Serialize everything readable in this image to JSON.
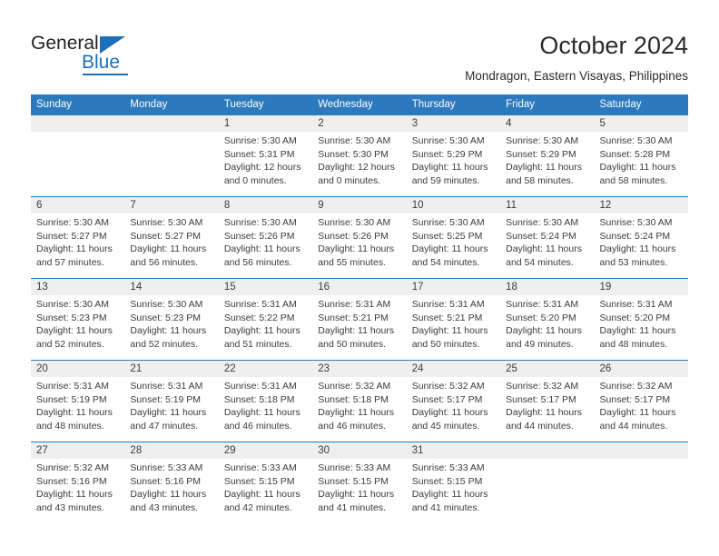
{
  "brand": {
    "name_part1": "General",
    "name_part2": "Blue",
    "triangle_icon": "triangle-icon",
    "color_blue": "#1b70b8",
    "color_dark": "#231f20"
  },
  "header": {
    "month_title": "October 2024",
    "location": "Mondragon, Eastern Visayas, Philippines"
  },
  "theme": {
    "header_blue": "#2c79bd",
    "daynum_band": "#efefef",
    "text": "#3b3b3b",
    "cell_bg": "#ffffff"
  },
  "calendar": {
    "weekday_headers": [
      "Sunday",
      "Monday",
      "Tuesday",
      "Wednesday",
      "Thursday",
      "Friday",
      "Saturday"
    ],
    "weeks": [
      [
        {
          "day": "",
          "lines": []
        },
        {
          "day": "",
          "lines": []
        },
        {
          "day": "1",
          "lines": [
            "Sunrise: 5:30 AM",
            "Sunset: 5:31 PM",
            "Daylight: 12 hours",
            "and 0 minutes."
          ]
        },
        {
          "day": "2",
          "lines": [
            "Sunrise: 5:30 AM",
            "Sunset: 5:30 PM",
            "Daylight: 12 hours",
            "and 0 minutes."
          ]
        },
        {
          "day": "3",
          "lines": [
            "Sunrise: 5:30 AM",
            "Sunset: 5:29 PM",
            "Daylight: 11 hours",
            "and 59 minutes."
          ]
        },
        {
          "day": "4",
          "lines": [
            "Sunrise: 5:30 AM",
            "Sunset: 5:29 PM",
            "Daylight: 11 hours",
            "and 58 minutes."
          ]
        },
        {
          "day": "5",
          "lines": [
            "Sunrise: 5:30 AM",
            "Sunset: 5:28 PM",
            "Daylight: 11 hours",
            "and 58 minutes."
          ]
        }
      ],
      [
        {
          "day": "6",
          "lines": [
            "Sunrise: 5:30 AM",
            "Sunset: 5:27 PM",
            "Daylight: 11 hours",
            "and 57 minutes."
          ]
        },
        {
          "day": "7",
          "lines": [
            "Sunrise: 5:30 AM",
            "Sunset: 5:27 PM",
            "Daylight: 11 hours",
            "and 56 minutes."
          ]
        },
        {
          "day": "8",
          "lines": [
            "Sunrise: 5:30 AM",
            "Sunset: 5:26 PM",
            "Daylight: 11 hours",
            "and 56 minutes."
          ]
        },
        {
          "day": "9",
          "lines": [
            "Sunrise: 5:30 AM",
            "Sunset: 5:26 PM",
            "Daylight: 11 hours",
            "and 55 minutes."
          ]
        },
        {
          "day": "10",
          "lines": [
            "Sunrise: 5:30 AM",
            "Sunset: 5:25 PM",
            "Daylight: 11 hours",
            "and 54 minutes."
          ]
        },
        {
          "day": "11",
          "lines": [
            "Sunrise: 5:30 AM",
            "Sunset: 5:24 PM",
            "Daylight: 11 hours",
            "and 54 minutes."
          ]
        },
        {
          "day": "12",
          "lines": [
            "Sunrise: 5:30 AM",
            "Sunset: 5:24 PM",
            "Daylight: 11 hours",
            "and 53 minutes."
          ]
        }
      ],
      [
        {
          "day": "13",
          "lines": [
            "Sunrise: 5:30 AM",
            "Sunset: 5:23 PM",
            "Daylight: 11 hours",
            "and 52 minutes."
          ]
        },
        {
          "day": "14",
          "lines": [
            "Sunrise: 5:30 AM",
            "Sunset: 5:23 PM",
            "Daylight: 11 hours",
            "and 52 minutes."
          ]
        },
        {
          "day": "15",
          "lines": [
            "Sunrise: 5:31 AM",
            "Sunset: 5:22 PM",
            "Daylight: 11 hours",
            "and 51 minutes."
          ]
        },
        {
          "day": "16",
          "lines": [
            "Sunrise: 5:31 AM",
            "Sunset: 5:21 PM",
            "Daylight: 11 hours",
            "and 50 minutes."
          ]
        },
        {
          "day": "17",
          "lines": [
            "Sunrise: 5:31 AM",
            "Sunset: 5:21 PM",
            "Daylight: 11 hours",
            "and 50 minutes."
          ]
        },
        {
          "day": "18",
          "lines": [
            "Sunrise: 5:31 AM",
            "Sunset: 5:20 PM",
            "Daylight: 11 hours",
            "and 49 minutes."
          ]
        },
        {
          "day": "19",
          "lines": [
            "Sunrise: 5:31 AM",
            "Sunset: 5:20 PM",
            "Daylight: 11 hours",
            "and 48 minutes."
          ]
        }
      ],
      [
        {
          "day": "20",
          "lines": [
            "Sunrise: 5:31 AM",
            "Sunset: 5:19 PM",
            "Daylight: 11 hours",
            "and 48 minutes."
          ]
        },
        {
          "day": "21",
          "lines": [
            "Sunrise: 5:31 AM",
            "Sunset: 5:19 PM",
            "Daylight: 11 hours",
            "and 47 minutes."
          ]
        },
        {
          "day": "22",
          "lines": [
            "Sunrise: 5:31 AM",
            "Sunset: 5:18 PM",
            "Daylight: 11 hours",
            "and 46 minutes."
          ]
        },
        {
          "day": "23",
          "lines": [
            "Sunrise: 5:32 AM",
            "Sunset: 5:18 PM",
            "Daylight: 11 hours",
            "and 46 minutes."
          ]
        },
        {
          "day": "24",
          "lines": [
            "Sunrise: 5:32 AM",
            "Sunset: 5:17 PM",
            "Daylight: 11 hours",
            "and 45 minutes."
          ]
        },
        {
          "day": "25",
          "lines": [
            "Sunrise: 5:32 AM",
            "Sunset: 5:17 PM",
            "Daylight: 11 hours",
            "and 44 minutes."
          ]
        },
        {
          "day": "26",
          "lines": [
            "Sunrise: 5:32 AM",
            "Sunset: 5:17 PM",
            "Daylight: 11 hours",
            "and 44 minutes."
          ]
        }
      ],
      [
        {
          "day": "27",
          "lines": [
            "Sunrise: 5:32 AM",
            "Sunset: 5:16 PM",
            "Daylight: 11 hours",
            "and 43 minutes."
          ]
        },
        {
          "day": "28",
          "lines": [
            "Sunrise: 5:33 AM",
            "Sunset: 5:16 PM",
            "Daylight: 11 hours",
            "and 43 minutes."
          ]
        },
        {
          "day": "29",
          "lines": [
            "Sunrise: 5:33 AM",
            "Sunset: 5:15 PM",
            "Daylight: 11 hours",
            "and 42 minutes."
          ]
        },
        {
          "day": "30",
          "lines": [
            "Sunrise: 5:33 AM",
            "Sunset: 5:15 PM",
            "Daylight: 11 hours",
            "and 41 minutes."
          ]
        },
        {
          "day": "31",
          "lines": [
            "Sunrise: 5:33 AM",
            "Sunset: 5:15 PM",
            "Daylight: 11 hours",
            "and 41 minutes."
          ]
        },
        {
          "day": "",
          "lines": []
        },
        {
          "day": "",
          "lines": []
        }
      ]
    ]
  }
}
